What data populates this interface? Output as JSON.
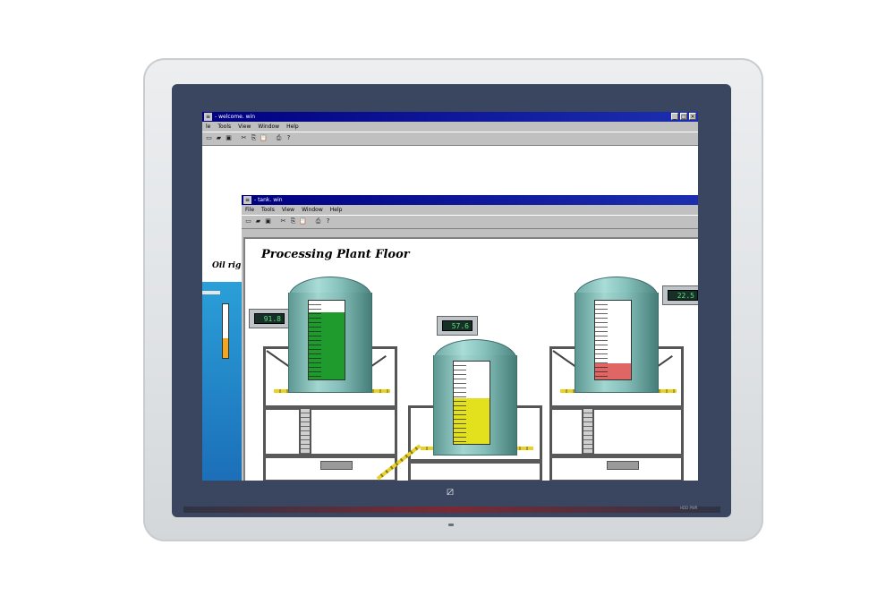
{
  "device": {
    "logo_glyph": "⧄",
    "led_text": "HDD    PWR",
    "colors": {
      "bezel": "#e3e6e9",
      "inner_bezel": "#3a4660",
      "titlebar": "#000080"
    }
  },
  "back_window": {
    "title": "- welcome. win",
    "sys_icon": "≡",
    "controls": [
      "_",
      "□",
      "×"
    ],
    "menu": [
      "le",
      "Tools",
      "View",
      "Window",
      "Help"
    ],
    "toolbar_icons": [
      "new-file-icon",
      "open-folder-icon",
      "save-icon",
      "cut-icon",
      "copy-icon",
      "paste-icon",
      "print-icon",
      "help-icon"
    ],
    "oil_rig_label": "Oil rig"
  },
  "front_window": {
    "title": "- tank. win",
    "sys_icon": "≡",
    "menu": [
      "File",
      "Tools",
      "View",
      "Window",
      "Help"
    ],
    "toolbar_icons": [
      "new-file-icon",
      "open-folder-icon",
      "save-icon",
      "cut-icon",
      "copy-icon",
      "paste-icon",
      "print-icon",
      "help-icon"
    ],
    "toolbar_glyphs": [
      "▭",
      "▰",
      "▣",
      "✂",
      "⎘",
      "📋",
      "⎙",
      "?"
    ],
    "plant_title": "Processing Plant Floor",
    "tanks": [
      {
        "name": "tank-1",
        "reading": "91.8",
        "level": 0.85,
        "fill_color": "#1e9b2c"
      },
      {
        "name": "tank-2",
        "reading": "57.6",
        "level": 0.55,
        "fill_color": "#e3e01e"
      },
      {
        "name": "tank-3",
        "reading": "22.5",
        "level": 0.2,
        "fill_color": "#e06666"
      }
    ]
  }
}
